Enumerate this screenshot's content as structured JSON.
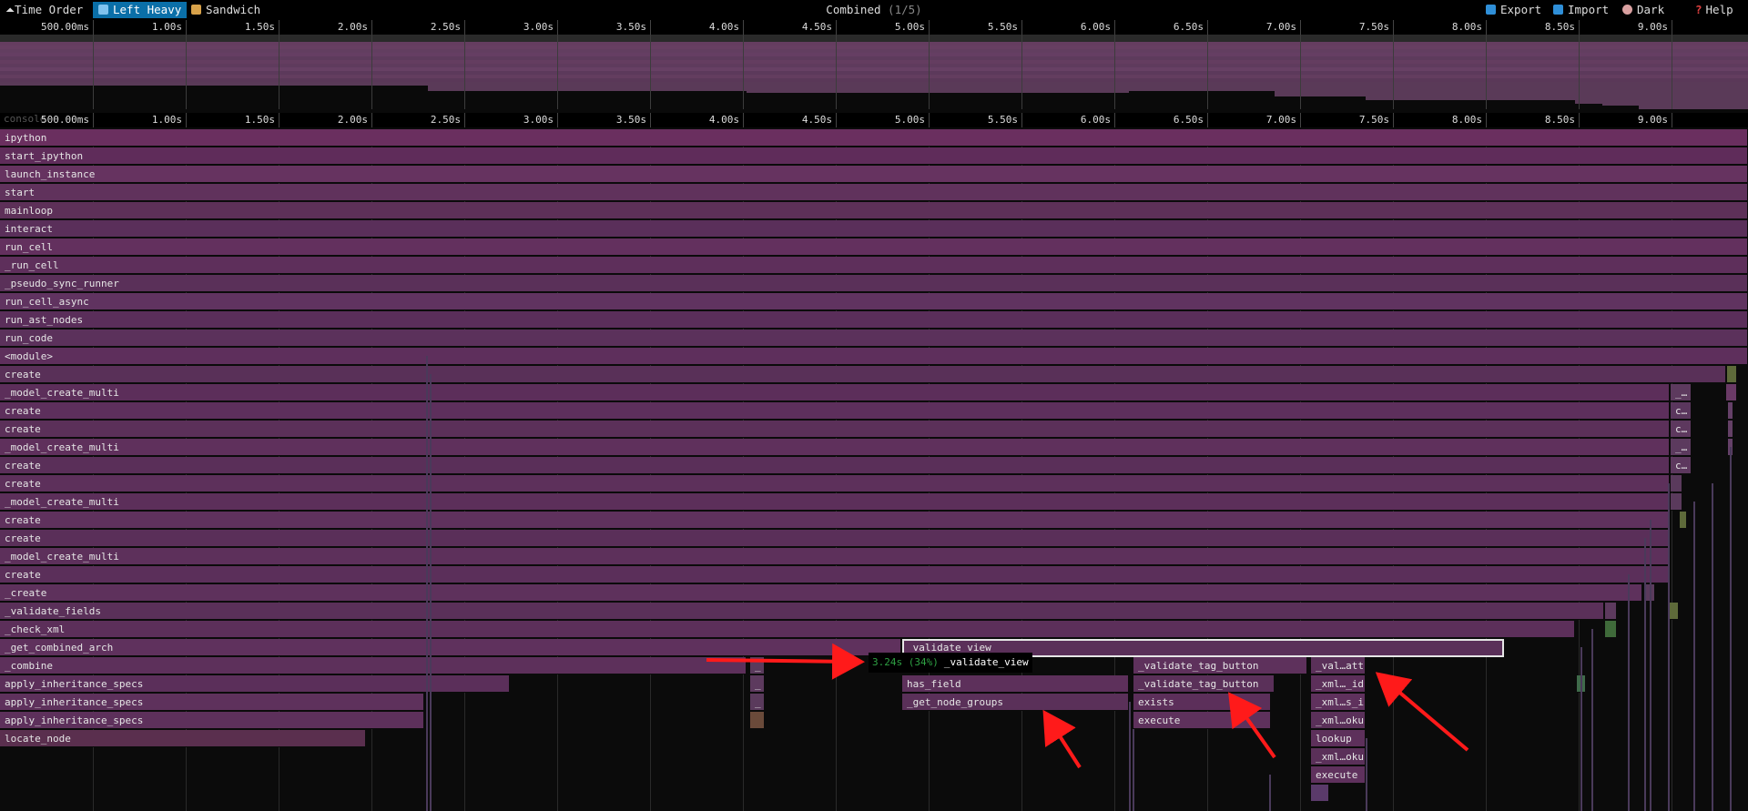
{
  "toolbar": {
    "time_order": "Time Order",
    "left_heavy": "Left Heavy",
    "sandwich": "Sandwich",
    "title": "Combined",
    "title_index": "(1/5)",
    "export": "Export",
    "import": "Import",
    "dark": "Dark",
    "help": "Help"
  },
  "ruler_ticks": [
    "500.00ms",
    "1.00s",
    "1.50s",
    "2.00s",
    "2.50s",
    "3.00s",
    "3.50s",
    "4.00s",
    "4.50s",
    "5.00s",
    "5.50s",
    "6.00s",
    "6.50s",
    "7.00s",
    "7.50s",
    "8.00s",
    "8.50s",
    "9.00s"
  ],
  "console_label": "console",
  "frames": [
    {
      "label": "ipython",
      "depth": 0,
      "start": 0,
      "end": 1920,
      "color": "#6a2f5f"
    },
    {
      "label": "start_ipython",
      "depth": 1,
      "start": 0,
      "end": 1920,
      "color": "#5f2c5a"
    },
    {
      "label": "launch_instance",
      "depth": 2,
      "start": 0,
      "end": 1920,
      "color": "#663360"
    },
    {
      "label": "start",
      "depth": 3,
      "start": 0,
      "end": 1920,
      "color": "#60325c"
    },
    {
      "label": "mainloop",
      "depth": 4,
      "start": 0,
      "end": 1920,
      "color": "#5d3058"
    },
    {
      "label": "interact",
      "depth": 5,
      "start": 0,
      "end": 1920,
      "color": "#5a2f5a"
    },
    {
      "label": "run_cell",
      "depth": 6,
      "start": 0,
      "end": 1920,
      "color": "#63305e"
    },
    {
      "label": "_run_cell",
      "depth": 7,
      "start": 0,
      "end": 1920,
      "color": "#5e2f5b"
    },
    {
      "label": "_pseudo_sync_runner",
      "depth": 8,
      "start": 0,
      "end": 1920,
      "color": "#5a3059"
    },
    {
      "label": "run_cell_async",
      "depth": 9,
      "start": 0,
      "end": 1920,
      "color": "#603360"
    },
    {
      "label": "run_ast_nodes",
      "depth": 10,
      "start": 0,
      "end": 1920,
      "color": "#5a2e5a"
    },
    {
      "label": "run_code",
      "depth": 11,
      "start": 0,
      "end": 1920,
      "color": "#5b315b"
    },
    {
      "label": "<module>",
      "depth": 12,
      "start": 0,
      "end": 1920,
      "color": "#5e2f5c"
    },
    {
      "label": "create",
      "depth": 13,
      "start": 0,
      "end": 1896,
      "color": "#593058"
    },
    {
      "label": "",
      "depth": 13,
      "start": 1897,
      "end": 1908,
      "color": "#5e6a3a"
    },
    {
      "label": "_model_create_multi",
      "depth": 14,
      "start": 0,
      "end": 1834,
      "color": "#5c2e5a"
    },
    {
      "label": "_…",
      "depth": 14,
      "start": 1835,
      "end": 1858,
      "color": "#5d3a5e"
    },
    {
      "label": "",
      "depth": 14,
      "start": 1896,
      "end": 1908,
      "color": "#6a3a66"
    },
    {
      "label": "create",
      "depth": 15,
      "start": 0,
      "end": 1834,
      "color": "#5d2f5c"
    },
    {
      "label": "c…",
      "depth": 15,
      "start": 1835,
      "end": 1858,
      "color": "#5a365d"
    },
    {
      "label": "",
      "depth": 15,
      "start": 1898,
      "end": 1904,
      "color": "#654068"
    },
    {
      "label": "create",
      "depth": 16,
      "start": 0,
      "end": 1834,
      "color": "#5b3059"
    },
    {
      "label": "c…",
      "depth": 16,
      "start": 1835,
      "end": 1858,
      "color": "#5d385e"
    },
    {
      "label": "",
      "depth": 16,
      "start": 1898,
      "end": 1904,
      "color": "#644066"
    },
    {
      "label": "_model_create_multi",
      "depth": 17,
      "start": 0,
      "end": 1834,
      "color": "#5f305c"
    },
    {
      "label": "_…",
      "depth": 17,
      "start": 1835,
      "end": 1858,
      "color": "#5c3a5e"
    },
    {
      "label": "",
      "depth": 17,
      "start": 1898,
      "end": 1904,
      "color": "#654068"
    },
    {
      "label": "create",
      "depth": 18,
      "start": 0,
      "end": 1834,
      "color": "#5a2f59"
    },
    {
      "label": "c…",
      "depth": 18,
      "start": 1835,
      "end": 1858,
      "color": "#5d385e"
    },
    {
      "label": "create",
      "depth": 19,
      "start": 0,
      "end": 1834,
      "color": "#5d305b"
    },
    {
      "label": "",
      "depth": 19,
      "start": 1835,
      "end": 1848,
      "color": "#5a3a5c"
    },
    {
      "label": "_model_create_multi",
      "depth": 20,
      "start": 0,
      "end": 1834,
      "color": "#5c2f5a"
    },
    {
      "label": "",
      "depth": 20,
      "start": 1835,
      "end": 1848,
      "color": "#5a3a5c"
    },
    {
      "label": "create",
      "depth": 21,
      "start": 0,
      "end": 1834,
      "color": "#5f315d"
    },
    {
      "label": "",
      "depth": 21,
      "start": 1845,
      "end": 1853,
      "color": "#5e6a3a"
    },
    {
      "label": "create",
      "depth": 22,
      "start": 0,
      "end": 1834,
      "color": "#5a2f59"
    },
    {
      "label": "_model_create_multi",
      "depth": 23,
      "start": 0,
      "end": 1834,
      "color": "#5d305b"
    },
    {
      "label": "create",
      "depth": 24,
      "start": 0,
      "end": 1834,
      "color": "#5b2f5a"
    },
    {
      "label": "_create",
      "depth": 25,
      "start": 0,
      "end": 1804,
      "color": "#5e315c"
    },
    {
      "label": "",
      "depth": 25,
      "start": 1806,
      "end": 1818,
      "color": "#5a3a5c"
    },
    {
      "label": "_validate_fields",
      "depth": 26,
      "start": 0,
      "end": 1762,
      "color": "#5a3059"
    },
    {
      "label": "",
      "depth": 26,
      "start": 1763,
      "end": 1776,
      "color": "#5d3a5e"
    },
    {
      "label": "",
      "depth": 26,
      "start": 1834,
      "end": 1844,
      "color": "#5e6a3a"
    },
    {
      "label": "_check_xml",
      "depth": 27,
      "start": 0,
      "end": 1730,
      "color": "#5c2f5a"
    },
    {
      "label": "",
      "depth": 27,
      "start": 1763,
      "end": 1776,
      "color": "#3f6a3a"
    },
    {
      "label": "_get_combined_arch",
      "depth": 28,
      "start": 0,
      "end": 990,
      "color": "#5f315d"
    },
    {
      "label": "_validate_view",
      "depth": 28,
      "start": 991,
      "end": 1652,
      "color": "#5a3059"
    },
    {
      "label": "_combine",
      "depth": 29,
      "start": 0,
      "end": 820,
      "color": "#5d305b"
    },
    {
      "label": "_",
      "depth": 29,
      "start": 824,
      "end": 840,
      "color": "#5a3a5c"
    },
    {
      "label": "_validate_tag_button",
      "depth": 29,
      "start": 1245,
      "end": 1436,
      "color": "#5e315c"
    },
    {
      "label": "_val…attr",
      "depth": 29,
      "start": 1440,
      "end": 1500,
      "color": "#5a3059"
    },
    {
      "label": "apply_inheritance_specs",
      "depth": 30,
      "start": 0,
      "end": 560,
      "color": "#5b2f5a"
    },
    {
      "label": "_",
      "depth": 30,
      "start": 824,
      "end": 840,
      "color": "#5d3a5e"
    },
    {
      "label": "has_field",
      "depth": 30,
      "start": 991,
      "end": 1240,
      "color": "#5d305b"
    },
    {
      "label": "_validate_tag_button",
      "depth": 30,
      "start": 1245,
      "end": 1400,
      "color": "#5a3059"
    },
    {
      "label": "_xml…_id",
      "depth": 30,
      "start": 1440,
      "end": 1500,
      "color": "#5c2f5a"
    },
    {
      "label": "",
      "depth": 30,
      "start": 1732,
      "end": 1742,
      "color": "#3f6a4a"
    },
    {
      "label": "apply_inheritance_specs",
      "depth": 31,
      "start": 0,
      "end": 466,
      "color": "#5e315c"
    },
    {
      "label": "_",
      "depth": 31,
      "start": 824,
      "end": 840,
      "color": "#5a3a5c"
    },
    {
      "label": "_get_node_groups",
      "depth": 31,
      "start": 991,
      "end": 1240,
      "color": "#5a3059"
    },
    {
      "label": "exists",
      "depth": 31,
      "start": 1245,
      "end": 1396,
      "color": "#5c2f5a"
    },
    {
      "label": "_xml…s_i",
      "depth": 31,
      "start": 1440,
      "end": 1500,
      "color": "#5f315d"
    },
    {
      "label": "apply_inheritance_specs",
      "depth": 32,
      "start": 0,
      "end": 466,
      "color": "#5d305b"
    },
    {
      "label": "",
      "depth": 32,
      "start": 824,
      "end": 840,
      "color": "#6a4a3a"
    },
    {
      "label": "execute",
      "depth": 32,
      "start": 1245,
      "end": 1396,
      "color": "#5e315c"
    },
    {
      "label": "_xml…oku",
      "depth": 32,
      "start": 1440,
      "end": 1500,
      "color": "#5a3059"
    },
    {
      "label": "locate_node",
      "depth": 33,
      "start": 0,
      "end": 402,
      "color": "#5a2f4e"
    },
    {
      "label": "lookup",
      "depth": 33,
      "start": 1440,
      "end": 1500,
      "color": "#5d305b"
    },
    {
      "label": "_xml…oku",
      "depth": 34,
      "start": 1440,
      "end": 1500,
      "color": "#5a3059"
    },
    {
      "label": "execute",
      "depth": 35,
      "start": 1440,
      "end": 1500,
      "color": "#5f315d"
    },
    {
      "label": "",
      "depth": 36,
      "start": 1440,
      "end": 1460,
      "color": "#5a3a6a"
    }
  ],
  "tooltip": {
    "time": "3.24s (34%)",
    "name": "_validate_view"
  },
  "colors": {
    "accent": "#0a6fa8",
    "arrow": "#ff1a1a",
    "tooltip_time": "#2ea043"
  }
}
